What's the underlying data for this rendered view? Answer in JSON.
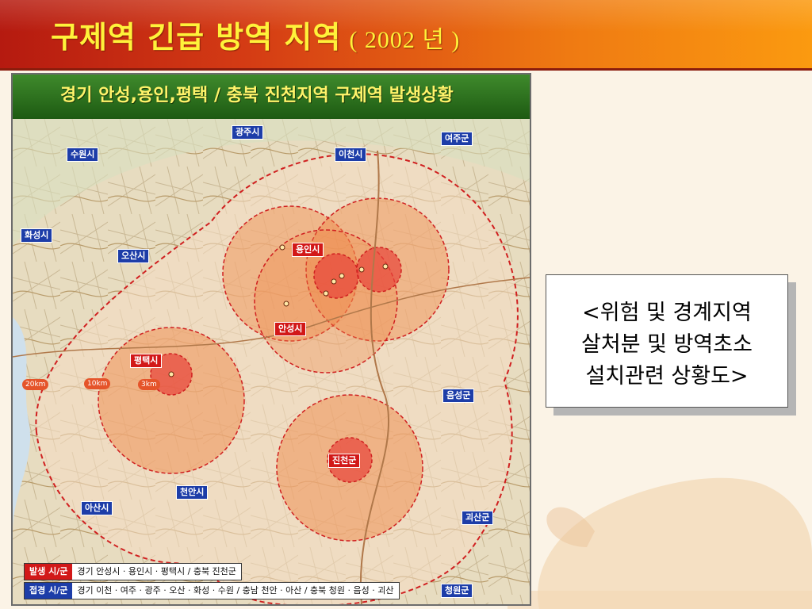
{
  "title": {
    "main": "구제역 긴급 방역 지역",
    "year": "( 2002 년 )"
  },
  "map": {
    "header": "경기 안성,용인,평택 / 충북 진천지역 구제역 발생상황",
    "cities_blue": [
      {
        "id": "gwangju",
        "label": "광주시"
      },
      {
        "id": "yeoju",
        "label": "여주군"
      },
      {
        "id": "suwon",
        "label": "수원시"
      },
      {
        "id": "icheon",
        "label": "이천시"
      },
      {
        "id": "hwaseong",
        "label": "화성시"
      },
      {
        "id": "osan",
        "label": "오산시"
      },
      {
        "id": "eumseong",
        "label": "음성군"
      },
      {
        "id": "cheonan",
        "label": "천안시"
      },
      {
        "id": "asan",
        "label": "아산시"
      },
      {
        "id": "goesan",
        "label": "괴산군"
      },
      {
        "id": "cheongwon",
        "label": "청원군"
      }
    ],
    "cities_red": [
      {
        "id": "yongin",
        "label": "용인시"
      },
      {
        "id": "anseong",
        "label": "안성시"
      },
      {
        "id": "pyeongtaek",
        "label": "평택시"
      },
      {
        "id": "jincheon",
        "label": "진천군"
      }
    ],
    "distances": [
      "20km",
      "10km",
      "3km"
    ],
    "legend": {
      "occurrence_key": "발생 시/군",
      "occurrence_val": "경기 안성시 · 용인시 · 평택시  /  충북 진천군",
      "adjacent_key": "접경 시/군",
      "adjacent_val": "경기 이천 · 여주 · 광주 · 오산 · 화성 · 수원  /  충남 천안 · 아산  /  충북 청원 · 음성 · 괴산"
    },
    "colors": {
      "zone_fill": "#f08a4a",
      "core_fill": "#e8453a",
      "boundary": "#d02020",
      "label_blue": "#1d3da8",
      "label_red": "#d21818"
    }
  },
  "note": {
    "line1": "<위험 및 경계지역",
    "line2": "살처분 및 방역초소",
    "line3": "설치관련 상황도>"
  }
}
